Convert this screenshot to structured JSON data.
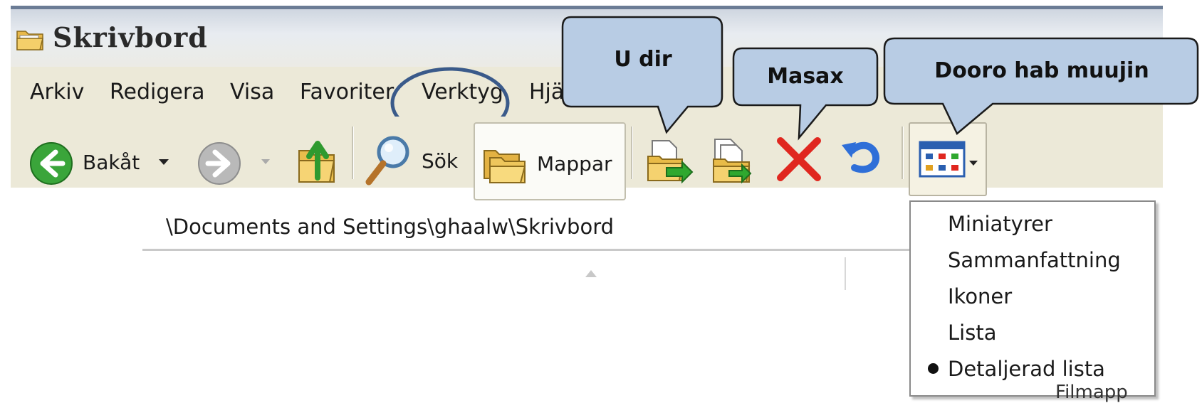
{
  "window": {
    "title": "Skrivbord"
  },
  "menu": {
    "items": [
      "Arkiv",
      "Redigera",
      "Visa",
      "Favoriter",
      "Verktyg",
      "Hjälp"
    ]
  },
  "toolbar": {
    "back_label": "Bakåt",
    "search_label": "Sök",
    "folders_label": "Mappar"
  },
  "address": {
    "path": "\\Documents and Settings\\ghaalw\\Skrivbord"
  },
  "view_menu": {
    "items": [
      "Miniatyrer",
      "Sammanfattning",
      "Ikoner",
      "Lista",
      "Detaljerad lista"
    ],
    "selected": "Detaljerad lista"
  },
  "file_list": {
    "visible_fragment": "Filmapp"
  },
  "callouts": {
    "move_to": "U dir",
    "delete": "Masax",
    "views": "Dooro hab muujin"
  },
  "colors": {
    "callout_fill": "#b8cce4",
    "highlight_ring": "#3a5a8a",
    "menu_bg": "#ece9d8"
  }
}
